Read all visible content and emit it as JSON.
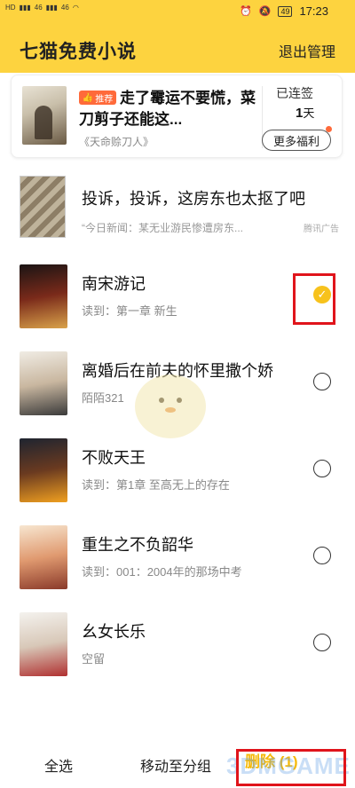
{
  "status": {
    "left_tags": [
      "HD",
      "46",
      "46"
    ],
    "battery": "49",
    "time": "17:23"
  },
  "header": {
    "title": "七猫免费小说",
    "exit_label": "退出管理"
  },
  "banner": {
    "tag": "推荐",
    "title": "走了霉运不要慌，菜刀剪子还能这...",
    "book": "《天命赊刀人》",
    "sign_label": "已连签",
    "sign_days": "1",
    "sign_unit": "天",
    "more_label": "更多福利"
  },
  "ad": {
    "title": "投诉，投诉，这房东也太抠了吧",
    "subtitle": "“今日新闻：某无业游民惨遭房东...",
    "tag": "腾讯广告"
  },
  "books": [
    {
      "title": "南宋游记",
      "progress": "读到：第一章 新生",
      "checked": true,
      "colors": [
        "#1a1414",
        "#7a2a1a",
        "#d9a24a"
      ]
    },
    {
      "title": "离婚后在前夫的怀里撒个娇",
      "progress": "陌陌321",
      "checked": false,
      "colors": [
        "#f0ece4",
        "#c9b7a0",
        "#3a3a3a"
      ]
    },
    {
      "title": "不败天王",
      "progress": "读到：第1章 至高无上的存在",
      "checked": false,
      "colors": [
        "#1e2430",
        "#6a3a20",
        "#f0a020"
      ]
    },
    {
      "title": "重生之不负韶华",
      "progress": "读到：001：2004年的那场中考",
      "checked": false,
      "colors": [
        "#f7e6d0",
        "#e09a70",
        "#8a3a2a"
      ]
    },
    {
      "title": "幺女长乐",
      "progress": "空留",
      "checked": false,
      "colors": [
        "#f4f2ee",
        "#d8c8b8",
        "#b03030"
      ]
    }
  ],
  "bottom": {
    "select_all": "全选",
    "move": "移动至分组",
    "delete": "删除 (1)",
    "watermark": "3DMGAME"
  }
}
